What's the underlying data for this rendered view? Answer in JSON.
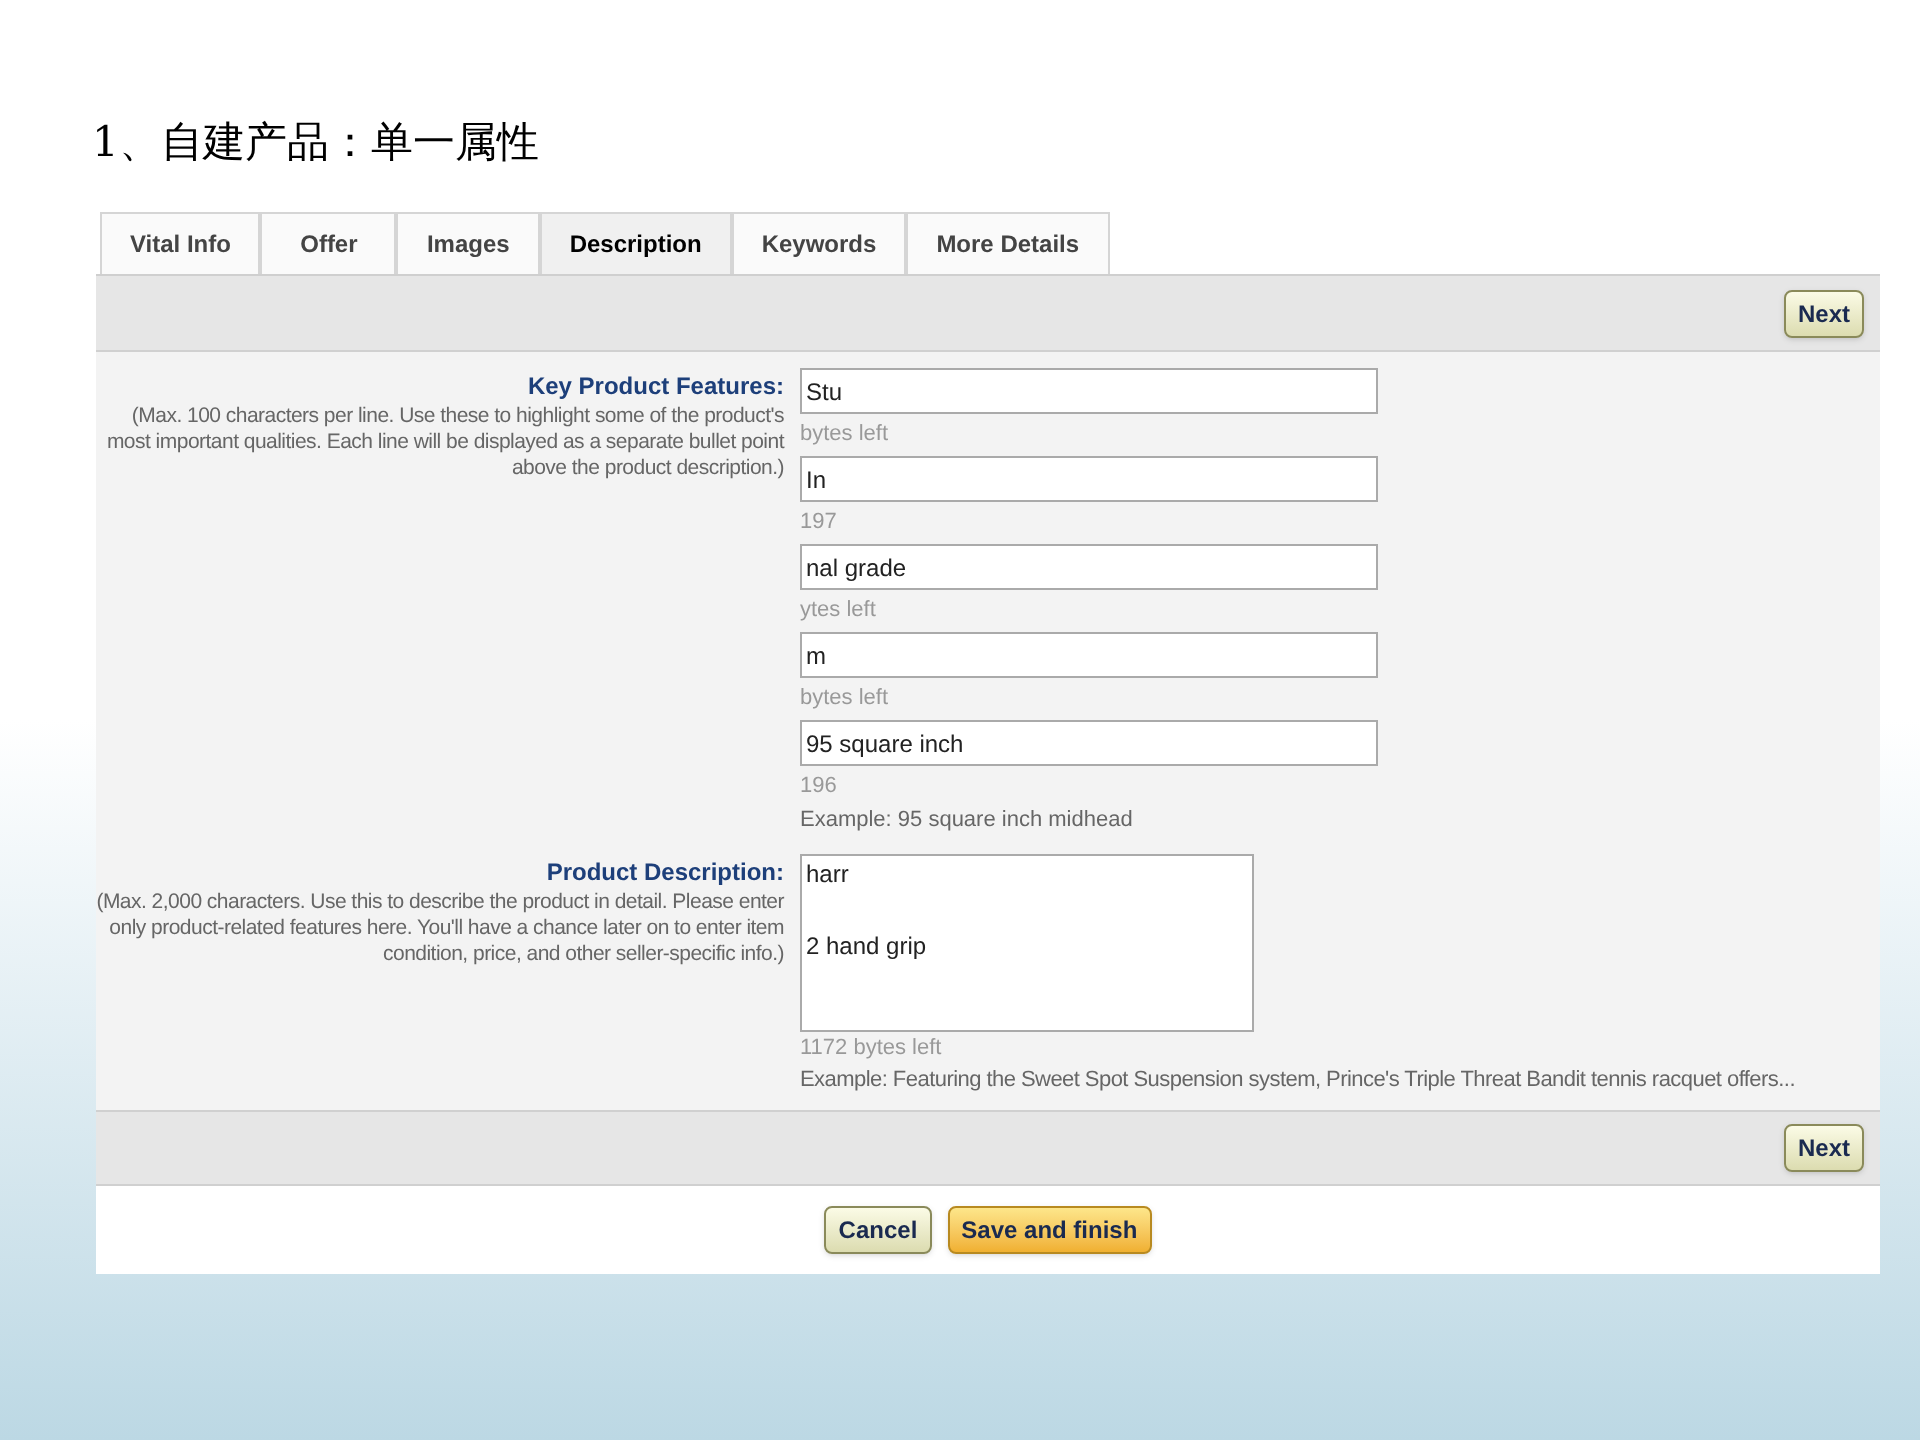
{
  "slide_title": "1、自建产品：单一属性",
  "tabs": [
    {
      "label": "Vital Info",
      "selected": false
    },
    {
      "label": "Offer",
      "selected": false
    },
    {
      "label": "Images",
      "selected": false
    },
    {
      "label": "Description",
      "selected": true
    },
    {
      "label": "Keywords",
      "selected": false
    },
    {
      "label": "More Details",
      "selected": false
    }
  ],
  "top_bar": {
    "next_button": "Next"
  },
  "key_features": {
    "label": "Key Product Features:",
    "hint": "(Max. 100 characters per line. Use these to highlight some of the product's most important qualities. Each line will be displayed as a separate bullet point above the product description.)",
    "fields": [
      {
        "value": "Stu",
        "note": "bytes left"
      },
      {
        "value": "In",
        "note": "197"
      },
      {
        "value": "nal grade",
        "note": "ytes left"
      },
      {
        "value": "m",
        "note": "bytes left"
      },
      {
        "value": "95 square inch",
        "note": "196"
      }
    ],
    "example": "Example: 95 square inch midhead"
  },
  "product_description": {
    "label": "Product Description:",
    "hint": "(Max. 2,000 characters. Use this to describe the product in detail. Please enter only product-related features here. You'll have a chance later on to enter item condition, price, and other seller-specific info.)",
    "value": "harr\n\n2 hand grip",
    "note": "1172 bytes left",
    "example": "Example: Featuring the Sweet Spot Suspension system, Prince's Triple Threat Bandit tennis racquet offers..."
  },
  "bottom_bar": {
    "next_button": "Next"
  },
  "actions": {
    "cancel": "Cancel",
    "save": "Save and finish"
  }
}
